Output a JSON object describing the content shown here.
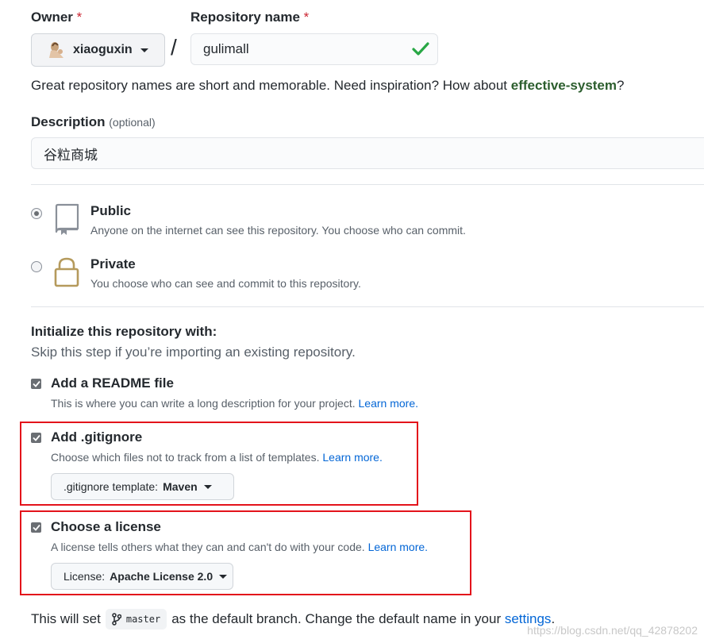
{
  "owner": {
    "label": "Owner",
    "required_mark": "*",
    "username": "xiaoguxin"
  },
  "repository": {
    "label": "Repository name",
    "required_mark": "*",
    "value": "gulimall"
  },
  "separator": "/",
  "hint": {
    "text": "Great repository names are short and memorable. Need inspiration? How about ",
    "suggestion": "effective-system",
    "suffix": "?"
  },
  "description": {
    "label": "Description",
    "optional": "(optional)",
    "value": "谷粒商城"
  },
  "visibility": {
    "selected": "public",
    "public": {
      "title": "Public",
      "desc": "Anyone on the internet can see this repository. You choose who can commit."
    },
    "private": {
      "title": "Private",
      "desc": "You choose who can see and commit to this repository."
    }
  },
  "initialize": {
    "title": "Initialize this repository with:",
    "subtitle": "Skip this step if you’re importing an existing repository.",
    "readme": {
      "checked": true,
      "title": "Add a README file",
      "desc": "This is where you can write a long description for your project. ",
      "link": "Learn more."
    },
    "gitignore": {
      "checked": true,
      "title": "Add .gitignore",
      "desc": "Choose which files not to track from a list of templates. ",
      "link": "Learn more.",
      "select_prefix": ".gitignore template: ",
      "select_value": "Maven"
    },
    "license": {
      "checked": true,
      "title": "Choose a license",
      "desc": "A license tells others what they can and can't do with your code. ",
      "link": "Learn more.",
      "select_prefix": "License: ",
      "select_value": "Apache License 2.0"
    }
  },
  "footer": {
    "prefix": "This will set",
    "branch": "master",
    "middle": "as the default branch. Change the default name in your",
    "link": "settings",
    "suffix": "."
  },
  "watermark": "https://blog.csdn.net/qq_42878202",
  "colors": {
    "highlight_box": "#e3131b",
    "link": "#0366d6",
    "suggestion": "#2c5e2e",
    "valid_check": "#28a745"
  },
  "icons": {
    "repo_public": "repo-icon",
    "repo_private": "lock-icon",
    "valid": "check-icon",
    "branch": "git-branch-icon"
  }
}
